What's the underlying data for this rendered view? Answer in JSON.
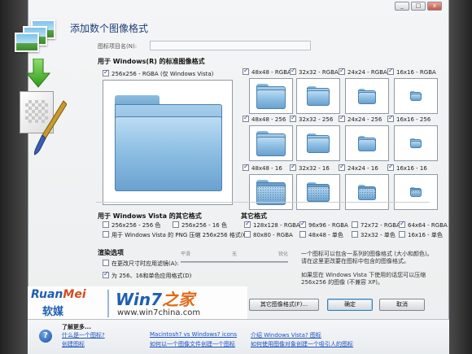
{
  "window": {
    "title": "添加数个图像格式"
  },
  "name_field": {
    "label": "图标项目名(N):",
    "value": ""
  },
  "standard": {
    "heading": "用于 Windows(R) 的标准图像格式",
    "big_label": "256x256 - RGBA (仅 Windows Vista)",
    "rows": [
      [
        {
          "label": "48x48 - RGBA",
          "checked": true
        },
        {
          "label": "32x32 - RGBA",
          "checked": true
        },
        {
          "label": "24x24 - RGBA",
          "checked": true
        },
        {
          "label": "16x16 - RGBA",
          "checked": true
        }
      ],
      [
        {
          "label": "48x48 - 256",
          "checked": true
        },
        {
          "label": "32x32 - 256",
          "checked": true
        },
        {
          "label": "24x24 - 256",
          "checked": true
        },
        {
          "label": "16x16 - 256",
          "checked": true
        }
      ],
      [
        {
          "label": "48x48 - 16",
          "checked": true
        },
        {
          "label": "32x32 - 16",
          "checked": true
        },
        {
          "label": "24x24 - 16",
          "checked": true
        },
        {
          "label": "16x16 - 16",
          "checked": true
        }
      ]
    ]
  },
  "vista_other": {
    "heading": "用于 Windows Vista 的其它格式",
    "opt1": "256x256 - 256 色",
    "opt2": "256x256 - 16 色",
    "opt3": "用于 Windows Vista 的 PNG 压缩 256x256 格式(C)"
  },
  "other": {
    "heading": "其它格式",
    "items": [
      {
        "label": "128x128 - RGBA",
        "checked": true
      },
      {
        "label": "96x96 - RGBA",
        "checked": true
      },
      {
        "label": "72x72 - RGBA",
        "checked": false
      },
      {
        "label": "64x64 - RGBA",
        "checked": true
      },
      {
        "label": "80x80 - RGBA",
        "checked": false
      },
      {
        "label": "48x48 - 单色",
        "checked": false
      },
      {
        "label": "32x32 - 单色",
        "checked": false
      },
      {
        "label": "16x16 - 单色",
        "checked": false
      }
    ]
  },
  "render": {
    "heading": "渲染选项",
    "slider_labels": [
      "平滑",
      "无",
      "锐化"
    ],
    "opt1": "在更改尺寸时应用滤镜(A):",
    "opt2": "为 256、16和单色应用格式(D)"
  },
  "description": {
    "p1": "一个图标可以包含一系列的图像格式 (大小和颜色)。请在这里更改要在图标中包含的图像格式。",
    "p2": "如果您在 Windows Vista 下使用的话您可以压缩 256x256 的图像 (不兼容 XP)。"
  },
  "buttons": {
    "other_formats": "其它图像格式(F)...",
    "ok": "确定",
    "cancel": "取消"
  },
  "help": {
    "heading": "了解更多...",
    "links": [
      "什么是一个图标?",
      "创建图标",
      "Macintosh? vs Windows? icons",
      "如何以一个图像文件创建一个图标",
      "介绍 Windows Vista? 图标",
      "如何使用图像对象创建一个吸引人的图标"
    ]
  },
  "watermark": {
    "brand_a": "Ruan",
    "brand_b": "Mei",
    "brand_cn": "软媒",
    "logo_a": "Win7",
    "logo_b": "之家",
    "url": "www.win7china.com"
  },
  "title_controls": [
    "_",
    "□",
    "x"
  ]
}
